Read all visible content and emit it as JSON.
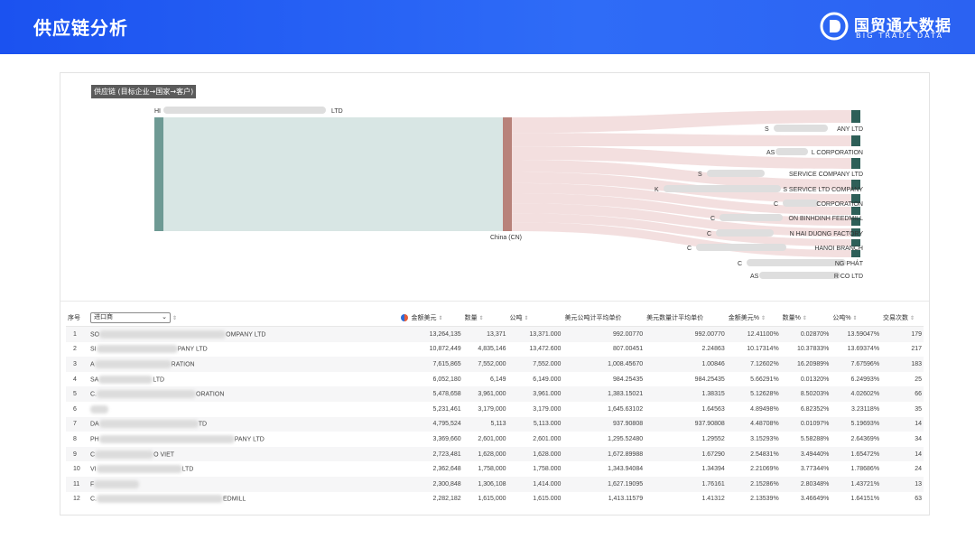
{
  "header": {
    "title": "供应链分析",
    "logo_text": "国贸通大数据",
    "logo_subtext": "BIG TRADE DATA",
    "bg_color": "#2b62f2"
  },
  "sankey": {
    "title": "供应链 (目标企业→国家→客户)",
    "source_label": "HI",
    "source_label_suffix": "LTD",
    "middle_label": "China (CN)",
    "colors": {
      "source": "#6e9a94",
      "middle": "#b8827a",
      "target": "#2e5f58",
      "flow_main": "#d8e6e4",
      "flow_out": "#f1d9d9"
    },
    "targets": [
      {
        "prefix": "S",
        "suffix": "ANY LTD"
      },
      {
        "prefix": "AS",
        "suffix": "L CORPORATION"
      },
      {
        "prefix": "S",
        "suffix": "SERVICE COMPANY LTD"
      },
      {
        "prefix": "K",
        "suffix": "S SERVICE LTD COMPANY"
      },
      {
        "prefix": "C",
        "suffix": "CORPORATION"
      },
      {
        "prefix": "C",
        "suffix": "ON BINHDINH FEEDMILL"
      },
      {
        "prefix": "C",
        "suffix": "N HAI DUONG FACTORY"
      },
      {
        "prefix": "C",
        "suffix": "HANOI BRANCH"
      },
      {
        "prefix": "C",
        "suffix": "NG PHÁT"
      },
      {
        "prefix": "AS",
        "suffix": "R CO LTD"
      }
    ]
  },
  "table": {
    "headers": {
      "index": "序号",
      "importer_select": "进口商",
      "amount_usd": "金额美元",
      "quantity": "数量",
      "kg": "公吨",
      "usd_per_kg": "美元公吨计平均单价",
      "usd_per_qty": "美元数量计平均单价",
      "amount_pct": "金额美元%",
      "quantity_pct": "数量%",
      "kg_pct": "公吨%",
      "trades": "交易次数"
    },
    "rows": [
      {
        "idx": "1",
        "pre": "SO",
        "suf": "OMPANY LTD",
        "amount": "13,264,135",
        "qty": "13,371",
        "kg": "13,371.000",
        "upk": "992.00770",
        "upq": "992.00770",
        "ap": "12.41100%",
        "qp": "0.02870%",
        "kp": "13.59047%",
        "t": "179"
      },
      {
        "idx": "2",
        "pre": "SI",
        "suf": "PANY LTD",
        "amount": "10,872,449",
        "qty": "4,835,146",
        "kg": "13,472.600",
        "upk": "807.00451",
        "upq": "2.24863",
        "ap": "10.17314%",
        "qp": "10.37833%",
        "kp": "13.69374%",
        "t": "217"
      },
      {
        "idx": "3",
        "pre": "A",
        "suf": "RATION",
        "amount": "7,615,865",
        "qty": "7,552,000",
        "kg": "7,552.000",
        "upk": "1,008.45670",
        "upq": "1.00846",
        "ap": "7.12602%",
        "qp": "16.20989%",
        "kp": "7.67596%",
        "t": "183"
      },
      {
        "idx": "4",
        "pre": "SA",
        "suf": "LTD",
        "amount": "6,052,180",
        "qty": "6,149",
        "kg": "6,149.000",
        "upk": "984.25435",
        "upq": "984.25435",
        "ap": "5.66291%",
        "qp": "0.01320%",
        "kp": "6.24993%",
        "t": "25"
      },
      {
        "idx": "5",
        "pre": "C.",
        "suf": "ORATION",
        "amount": "5,478,658",
        "qty": "3,961,000",
        "kg": "3,961.000",
        "upk": "1,383.15021",
        "upq": "1.38315",
        "ap": "5.12628%",
        "qp": "8.50203%",
        "kp": "4.02602%",
        "t": "66"
      },
      {
        "idx": "6",
        "pre": "",
        "suf": "",
        "amount": "5,231,461",
        "qty": "3,179,000",
        "kg": "3,179.000",
        "upk": "1,645.63102",
        "upq": "1.64563",
        "ap": "4.89498%",
        "qp": "6.82352%",
        "kp": "3.23118%",
        "t": "35"
      },
      {
        "idx": "7",
        "pre": "DA",
        "suf": "TD",
        "amount": "4,795,524",
        "qty": "5,113",
        "kg": "5,113.000",
        "upk": "937.90808",
        "upq": "937.90808",
        "ap": "4.48708%",
        "qp": "0.01097%",
        "kp": "5.19693%",
        "t": "14"
      },
      {
        "idx": "8",
        "pre": "PH",
        "suf": "PANY LTD",
        "amount": "3,369,660",
        "qty": "2,601,000",
        "kg": "2,601.000",
        "upk": "1,295.52480",
        "upq": "1.29552",
        "ap": "3.15293%",
        "qp": "5.58288%",
        "kp": "2.64369%",
        "t": "34"
      },
      {
        "idx": "9",
        "pre": "C",
        "suf": "O VIET",
        "amount": "2,723,481",
        "qty": "1,628,000",
        "kg": "1,628.000",
        "upk": "1,672.89988",
        "upq": "1.67290",
        "ap": "2.54831%",
        "qp": "3.49440%",
        "kp": "1.65472%",
        "t": "14"
      },
      {
        "idx": "10",
        "pre": "VI",
        "suf": "LTD",
        "amount": "2,362,648",
        "qty": "1,758,000",
        "kg": "1,758.000",
        "upk": "1,343.94084",
        "upq": "1.34394",
        "ap": "2.21069%",
        "qp": "3.77344%",
        "kp": "1.78686%",
        "t": "24"
      },
      {
        "idx": "11",
        "pre": "F",
        "suf": "",
        "amount": "2,300,848",
        "qty": "1,306,108",
        "kg": "1,414.000",
        "upk": "1,627.19095",
        "upq": "1.76161",
        "ap": "2.15286%",
        "qp": "2.80348%",
        "kp": "1.43721%",
        "t": "13"
      },
      {
        "idx": "12",
        "pre": "C.",
        "suf": "EDMILL",
        "amount": "2,282,182",
        "qty": "1,615,000",
        "kg": "1,615.000",
        "upk": "1,413.11579",
        "upq": "1.41312",
        "ap": "2.13539%",
        "qp": "3.46649%",
        "kp": "1.64151%",
        "t": "63"
      }
    ]
  }
}
